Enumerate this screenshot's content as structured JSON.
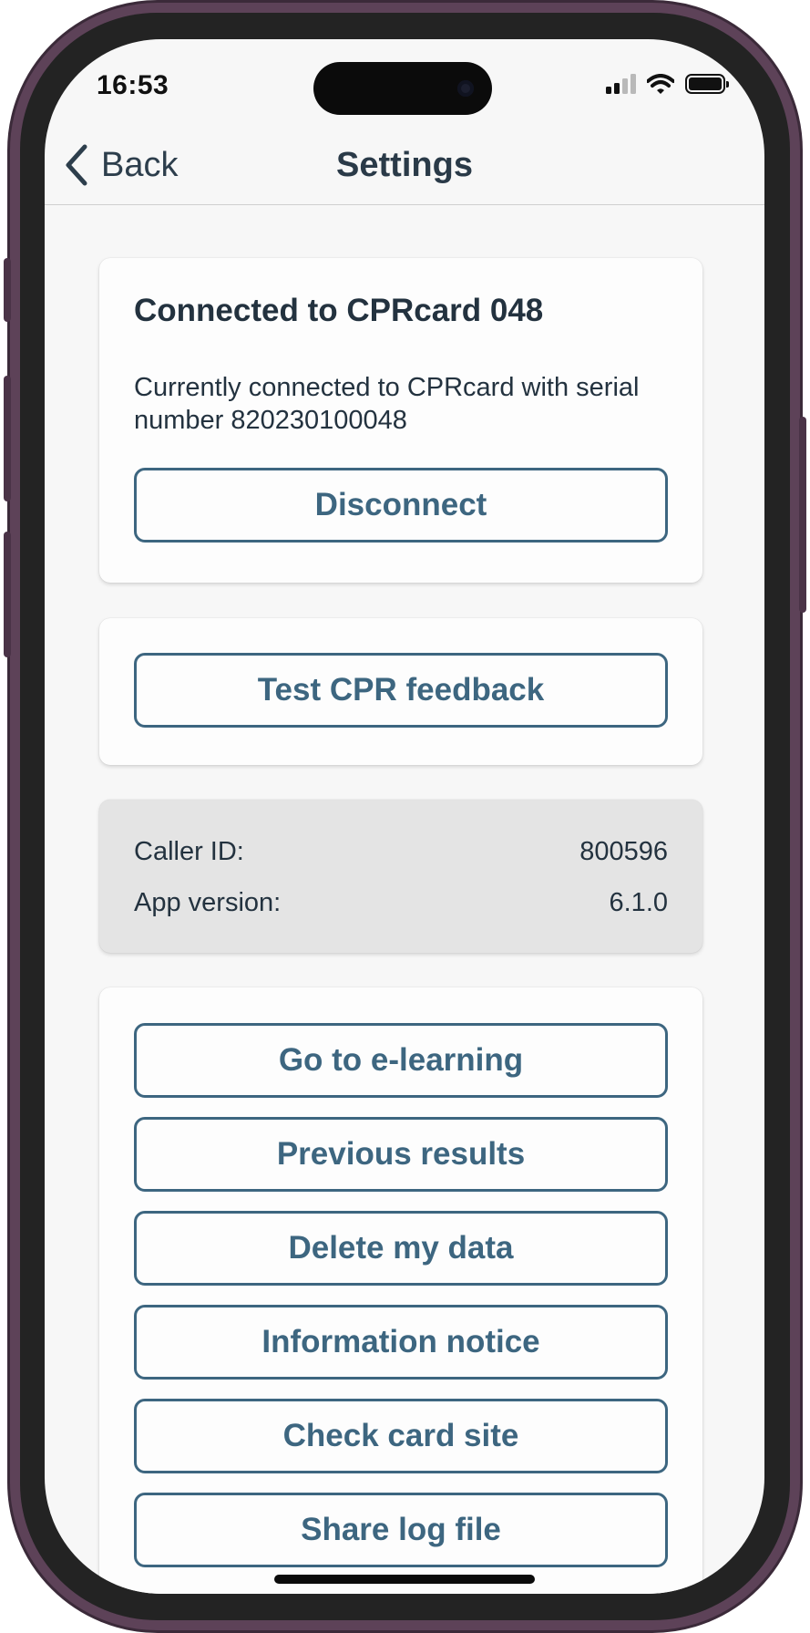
{
  "status_bar": {
    "time": "16:53"
  },
  "nav": {
    "back_label": "Back",
    "title": "Settings"
  },
  "connection_card": {
    "title": "Connected to CPRcard 048",
    "description": "Currently connected to CPRcard with serial number 820230100048",
    "disconnect_label": "Disconnect"
  },
  "test_card": {
    "test_feedback_label": "Test CPR feedback"
  },
  "info_card": {
    "caller_id_label": "Caller ID:",
    "caller_id_value": "800596",
    "app_version_label": "App version:",
    "app_version_value": "6.1.0"
  },
  "actions": [
    {
      "label": "Go to e-learning"
    },
    {
      "label": "Previous results"
    },
    {
      "label": "Delete my data"
    },
    {
      "label": "Information notice"
    },
    {
      "label": "Check card site"
    },
    {
      "label": "Share log file"
    }
  ],
  "colors": {
    "accent": "#3d6680",
    "text": "#23323f",
    "frame": "#5d4258"
  },
  "icons": {
    "back": "chevron-left-icon",
    "signal": "cellular-signal-icon",
    "wifi": "wifi-icon",
    "battery": "battery-icon"
  }
}
